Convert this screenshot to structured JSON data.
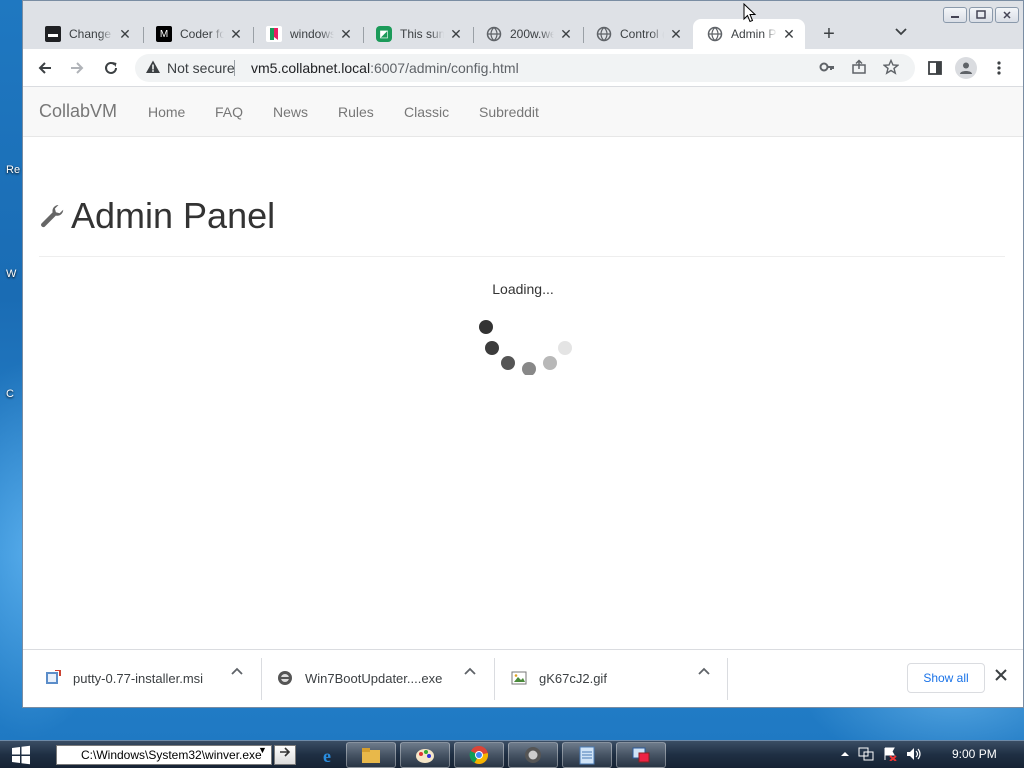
{
  "window": {
    "caption_buttons": [
      "minimize-icon",
      "maximize-icon",
      "close-icon"
    ]
  },
  "tabs": [
    {
      "title": "Change",
      "icon": "terminal-icon",
      "color": "#202124",
      "active": false
    },
    {
      "title": "Coder fo",
      "icon": "coder-icon",
      "color": "#000000",
      "active": false
    },
    {
      "title": "windows",
      "icon": "bookmark-icon",
      "color": "#e91e63",
      "active": false
    },
    {
      "title": "This sum",
      "icon": "app-icon",
      "color": "#1b9a59",
      "active": false
    },
    {
      "title": "200w.we",
      "icon": "globe-icon",
      "color": "#5f6368",
      "active": false
    },
    {
      "title": "Control (",
      "icon": "globe-icon",
      "color": "#5f6368",
      "active": false
    },
    {
      "title": "Admin P",
      "icon": "globe-icon",
      "color": "#5f6368",
      "active": true
    }
  ],
  "toolbar": {
    "security_label": "Not secure",
    "url_host": "vm5.collabnet.local",
    "url_path": ":6007/admin/config.html"
  },
  "nav": {
    "brand": "CollabVM",
    "links": [
      "Home",
      "FAQ",
      "News",
      "Rules",
      "Classic",
      "Subreddit"
    ]
  },
  "page": {
    "title": "Admin Panel",
    "loading_text": "Loading..."
  },
  "downloads": {
    "items": [
      {
        "name": "putty-0.77-installer.msi",
        "icon": "installer-icon"
      },
      {
        "name": "Win7BootUpdater....exe",
        "icon": "exe-icon"
      },
      {
        "name": "gK67cJ2.gif",
        "icon": "image-file-icon"
      }
    ],
    "show_all_label": "Show all"
  },
  "taskbar": {
    "run_value": "C:\\Windows\\System32\\winver.exe",
    "clock": "9:00 PM",
    "apps": [
      "ie-icon",
      "explorer-icon",
      "paint-icon",
      "chrome-icon",
      "vm-icon",
      "notepad-icon",
      "network-app-icon"
    ]
  },
  "desktop": {
    "icon_labels": [
      "Re",
      "W",
      "C"
    ]
  }
}
